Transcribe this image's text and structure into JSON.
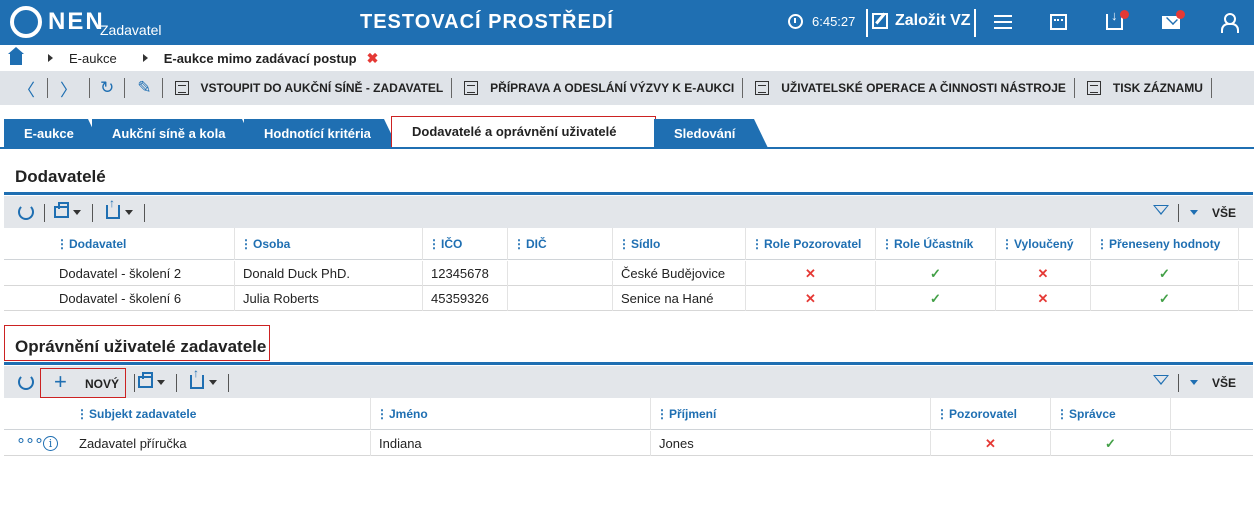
{
  "header": {
    "brand": "NEN",
    "brand_sub": "Zadavatel",
    "environment": "TESTOVACÍ PROSTŘEDÍ",
    "time": "6:45:27",
    "create_label": "Založit VZ",
    "accent": "#1f6fb2",
    "notification_color": "#e53935"
  },
  "breadcrumb": {
    "items": [
      "E-aukce",
      "E-aukce mimo zadávací postup"
    ]
  },
  "actions": {
    "enter_room": "VSTOUPIT DO AUKČNÍ SÍNĚ - ZADAVATEL",
    "prepare": "PŘÍPRAVA A ODESLÁNÍ VÝZVY K E-AUKCI",
    "user_ops": "UŽIVATELSKÉ OPERACE A ČINNOSTI NÁSTROJE",
    "print": "TISK ZÁZNAMU"
  },
  "tabs": [
    {
      "label": "E-aukce"
    },
    {
      "label": "Aukční síně a kola"
    },
    {
      "label": "Hodnotící kritéria"
    },
    {
      "label": "Dodavatelé a oprávnění uživatelé"
    },
    {
      "label": "Sledování"
    }
  ],
  "suppliers": {
    "title": "Dodavatelé",
    "filter_all": "VŠE",
    "columns": [
      "Dodavatel",
      "Osoba",
      "IČO",
      "DIČ",
      "Sídlo",
      "Role Pozorovatel",
      "Role Účastník",
      "Vyloučený",
      "Přeneseny hodnoty"
    ],
    "rows": [
      {
        "dodavatel": "Dodavatel - školení 2",
        "osoba": "Donald Duck PhD.",
        "ico": "12345678",
        "dic": "",
        "sidlo": "České Budějovice",
        "pozorovatel": "✕",
        "ucastnik": "✓",
        "vylouceny": "✕",
        "preneseny": "✓"
      },
      {
        "dodavatel": "Dodavatel - školení 6",
        "osoba": "Julia Roberts",
        "ico": "45359326",
        "dic": "",
        "sidlo": "Senice na Hané",
        "pozorovatel": "✕",
        "ucastnik": "✓",
        "vylouceny": "✕",
        "preneseny": "✓"
      }
    ]
  },
  "authorized": {
    "title": "Oprávnění uživatelé zadavatele",
    "new_label": "NOVÝ",
    "filter_all": "VŠE",
    "columns": [
      "Subjekt zadavatele",
      "Jméno",
      "Příjmení",
      "Pozorovatel",
      "Správce"
    ],
    "rows": [
      {
        "subjekt": "Zadavatel příručka",
        "jmeno": "Indiana",
        "prijmeni": "Jones",
        "pozorovatel": "✕",
        "spravce": "✓"
      }
    ]
  }
}
